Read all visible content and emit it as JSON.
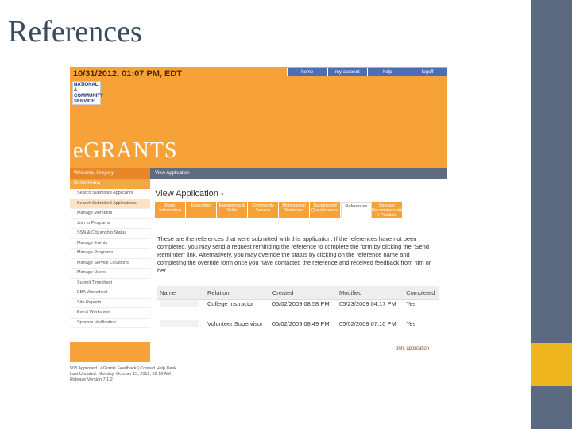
{
  "slide": {
    "title": "References"
  },
  "app": {
    "datetime": "10/31/2012, 01:07 PM, EDT",
    "topnav": [
      "home",
      "my account",
      "help",
      "logoff"
    ],
    "brand": "eGRANTS",
    "org_logo": "NATIONAL & COMMUNITY SERVICE"
  },
  "sidebar": {
    "welcome": "Welcome, Gregory",
    "portal": "Portal Home",
    "items": [
      "Search Submitted Applicants",
      "Search Submitted Applications",
      "Manage Members",
      "Join to Programs",
      "SSN & Citizenship Status",
      "Manage Events",
      "Manage Programs",
      "Manage Service Locations",
      "Manage Users",
      "Submit Timesheet",
      "EBA Worksheet",
      "Site Reports",
      "Event Worksheet",
      "Sponsor Verification"
    ]
  },
  "main": {
    "header": "View Application",
    "title": "View Application -",
    "tabs": [
      "Basic Information",
      "Education",
      "Experience & Skills",
      "Community Service",
      "Motivational Statement",
      "Background Questionnaire",
      "References",
      "Sponsor Recommendation / Position"
    ],
    "active_tab": "References",
    "note": "These are the references that were submitted with this application. If the references have not been completed, you may send a request reminding the reference to complete the form by clicking the \"Send Reminder\" link. Alternatively, you may override the status by clicking on the reference name and completing the override form once you have contacted the reference and received feedback from him or her.",
    "table": {
      "headers": [
        "Name",
        "Relation",
        "Created",
        "Modified",
        "Completed"
      ],
      "rows": [
        [
          "",
          "College Instructor",
          "05/02/2009 08:58 PM",
          "05/23/2009 04:17 PM",
          "Yes"
        ],
        [
          "",
          "Volunteer Supervisor",
          "05/02/2009 08:49 PM",
          "05/02/2009 07:10 PM",
          "Yes"
        ]
      ]
    },
    "print": "print application"
  },
  "footer": {
    "line1": "508 Approved | eGrants Feedback | Contact Help Desk",
    "line2": "Last Updated: Monday, October 15, 2012, 02:16 AM",
    "line3": "Release Version 7.1.2"
  }
}
